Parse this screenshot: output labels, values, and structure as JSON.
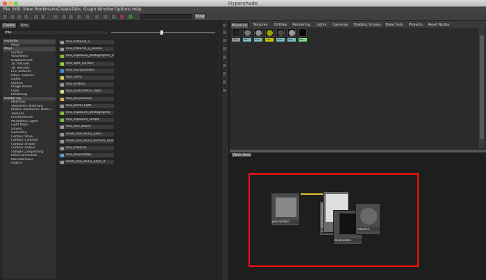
{
  "window": {
    "title": "Hypershade",
    "menu": [
      "File",
      "Edit",
      "View",
      "Bookmarks",
      "Create",
      "Tabs",
      "Graph",
      "Window",
      "Options",
      "Help"
    ],
    "show_button": "Show"
  },
  "left": {
    "tabs": [
      "Create",
      "Bins"
    ],
    "search_value": "mia",
    "tree": [
      {
        "label": "Favorites",
        "hdr": true
      },
      {
        "label": "Maya",
        "hdr": false
      },
      {
        "label": "Maya",
        "hdr": true
      },
      {
        "label": "Surface",
        "hdr": false
      },
      {
        "label": "Volumetric",
        "hdr": false
      },
      {
        "label": "Displacement",
        "hdr": false
      },
      {
        "label": "2D Textures",
        "hdr": false
      },
      {
        "label": "3D Textures",
        "hdr": false
      },
      {
        "label": "Env Textures",
        "hdr": false
      },
      {
        "label": "Other Textures",
        "hdr": false
      },
      {
        "label": "Lights",
        "hdr": false
      },
      {
        "label": "Utilities",
        "hdr": false
      },
      {
        "label": "Image Planes",
        "hdr": false
      },
      {
        "label": "Glow",
        "hdr": false
      },
      {
        "label": "Rendering",
        "hdr": false
      },
      {
        "label": "mental ray",
        "hdr": true
      },
      {
        "label": "Materials",
        "hdr": false
      },
      {
        "label": "Volumetric Materials",
        "hdr": false
      },
      {
        "label": "Photon Volumetric Materi...",
        "hdr": false
      },
      {
        "label": "Textures",
        "hdr": false
      },
      {
        "label": "Environments",
        "hdr": false
      },
      {
        "label": "MentalRay Lights",
        "hdr": false
      },
      {
        "label": "Light Maps",
        "hdr": false
      },
      {
        "label": "Lenses",
        "hdr": false
      },
      {
        "label": "Geometry",
        "hdr": false
      },
      {
        "label": "Contour Store",
        "hdr": false
      },
      {
        "label": "Contour Contrast",
        "hdr": false
      },
      {
        "label": "Contour Shader",
        "hdr": false
      },
      {
        "label": "Contour Output",
        "hdr": false
      },
      {
        "label": "Sample Compositing",
        "hdr": false
      },
      {
        "label": "Data Conversion",
        "hdr": false
      },
      {
        "label": "Miscellaneous",
        "hdr": false
      },
      {
        "label": "Legacy",
        "hdr": false
      }
    ],
    "nodes": [
      {
        "label": "mia_material_x",
        "color": "#9a9a9a"
      },
      {
        "label": "mia_material_x_passes",
        "color": "#9a9a9a"
      },
      {
        "label": "mia_exposure_photographic_rev",
        "color": "#7fbf3f"
      },
      {
        "label": "mia_light_surface",
        "color": "#9fcf3f"
      },
      {
        "label": "mia_roundcorners",
        "color": "#3f8fdf"
      },
      {
        "label": "mia_cielry",
        "color": "#cfcf4f"
      },
      {
        "label": "mia_envblur",
        "color": "#9a9a9a"
      },
      {
        "label": "mia_photometric_light",
        "color": "#dfdf8f"
      },
      {
        "label": "mia_physicalsun",
        "color": "#cfaf4f"
      },
      {
        "label": "mia_portal_light",
        "color": "#9a9a9a"
      },
      {
        "label": "mia_exposure_photographic",
        "color": "#7fbf3f"
      },
      {
        "label": "mia_exposure_simple",
        "color": "#7fbf3f"
      },
      {
        "label": "mia_lens_bokeh",
        "color": "#9a9a9a"
      },
      {
        "label": "misss_mia_skin2_phen",
        "color": "#9a9a9a"
      },
      {
        "label": "misss_mia_skin2_surface_phen",
        "color": "#9a9a9a"
      },
      {
        "label": "mia_material",
        "color": "#9a9a9a"
      },
      {
        "label": "mia_physicalsky",
        "color": "#5f9fdf"
      },
      {
        "label": "misss_mia_skin2_phen_d",
        "color": "#9a9a9a"
      }
    ]
  },
  "right": {
    "tabs": [
      "Materials",
      "Textures",
      "Utilities",
      "Rendering",
      "Lights",
      "Cameras",
      "Shading Groups",
      "Bake Sets",
      "Projects",
      "Asset Nodes"
    ],
    "swatches": [
      {
        "label": "cla...",
        "ball": "#222222",
        "lcol": "#9a9a9a"
      },
      {
        "label": "lam...",
        "ball": "#777777",
        "lcol": "#7fbfbf"
      },
      {
        "label": "mia...",
        "ball": "#8a8a8a",
        "lcol": "#7fbfbf"
      },
      {
        "label": "par...",
        "ball": "#a0a000",
        "lcol": "#c8c800"
      },
      {
        "label": "pha...",
        "ball": "#4a4a4a",
        "lcol": "#7fbfbf"
      },
      {
        "label": "she...",
        "ball": "#9a9a9a",
        "lcol": "#7fbfbf"
      },
      {
        "label": "lam...",
        "ball": "#0a0a0a",
        "lcol": "#7fdf7f"
      }
    ],
    "work_area": {
      "tab_label": "Work Area",
      "graph_nodes": [
        {
          "label": "place2dText..."
        },
        {
          "label": "mia_mate..."
        },
        {
          "label": "displaceme..."
        },
        {
          "label": "material..."
        }
      ]
    }
  }
}
